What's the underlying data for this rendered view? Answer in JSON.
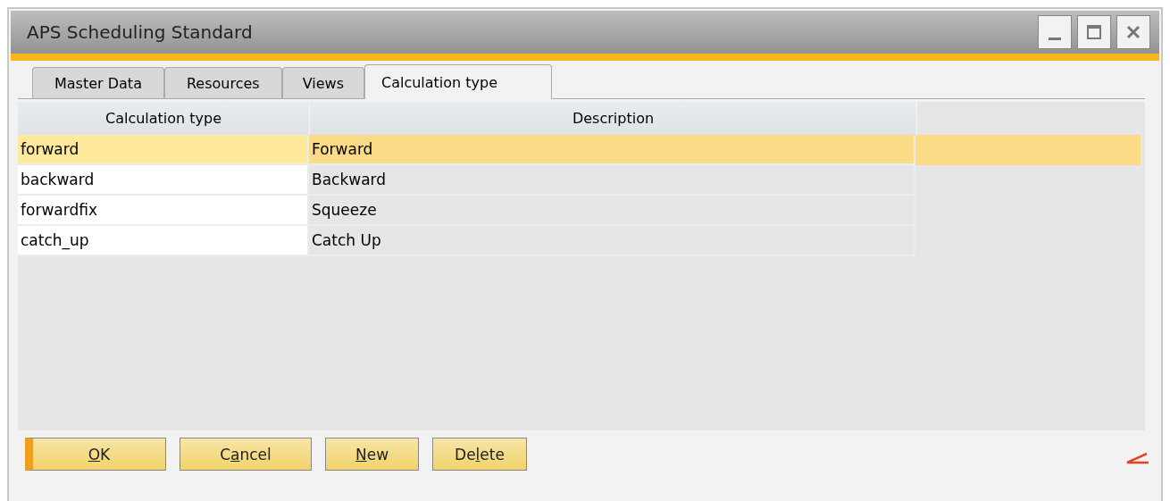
{
  "window": {
    "title": "APS Scheduling Standard"
  },
  "tabs": [
    {
      "label": "Master Data",
      "selected": false
    },
    {
      "label": "Resources",
      "selected": false
    },
    {
      "label": "Views",
      "selected": false
    },
    {
      "label": "Calculation type",
      "selected": true
    }
  ],
  "table": {
    "columns": [
      "Calculation type",
      "Description"
    ],
    "rows": [
      {
        "cells": [
          "forward",
          "Forward"
        ],
        "selected": true
      },
      {
        "cells": [
          "backward",
          "Backward"
        ],
        "selected": false
      },
      {
        "cells": [
          "forwardfix",
          "Squeeze"
        ],
        "selected": false
      },
      {
        "cells": [
          "catch_up",
          "Catch Up"
        ],
        "selected": false
      }
    ]
  },
  "buttons": [
    {
      "access_key": "O",
      "after": "K",
      "default": true
    },
    {
      "before": "C",
      "access_key": "a",
      "after": "ncel",
      "default": false
    },
    {
      "access_key": "N",
      "after": "ew",
      "default": false
    },
    {
      "before": "De",
      "access_key": "l",
      "after": "ete",
      "default": false
    }
  ]
}
